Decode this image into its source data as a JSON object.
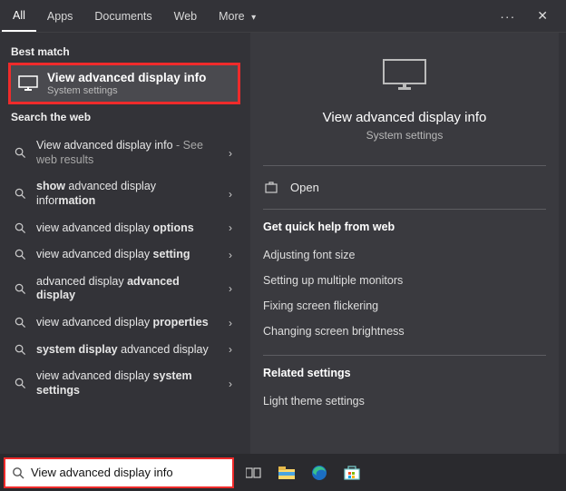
{
  "header": {
    "tabs": [
      "All",
      "Apps",
      "Documents",
      "Web",
      "More"
    ],
    "active_tab_index": 0
  },
  "left": {
    "best_match_label": "Best match",
    "best_match": {
      "title": "View advanced display info",
      "subtitle": "System settings"
    },
    "web_label": "Search the web",
    "web_items": [
      {
        "html": "View advanced display info <span class='hint'>- See web results</span>"
      },
      {
        "html": "<b>show</b> advanced display infor<b>mation</b>"
      },
      {
        "html": "view advanced display <b>options</b>"
      },
      {
        "html": "view advanced display <b>setting</b>"
      },
      {
        "html": "advanced display <b>advanced display</b>"
      },
      {
        "html": "view advanced display <b>properties</b>"
      },
      {
        "html": "<b>system display</b> advanced display"
      },
      {
        "html": "view advanced display <b>system settings</b>"
      }
    ]
  },
  "right": {
    "title": "View advanced display info",
    "subtitle": "System settings",
    "open_label": "Open",
    "quick_help_label": "Get quick help from web",
    "quick_help": [
      "Adjusting font size",
      "Setting up multiple monitors",
      "Fixing screen flickering",
      "Changing screen brightness"
    ],
    "related_label": "Related settings",
    "related": [
      "Light theme settings"
    ]
  },
  "taskbar": {
    "search_value": "View advanced display info"
  },
  "colors": {
    "highlight": "#ef2b2b"
  }
}
